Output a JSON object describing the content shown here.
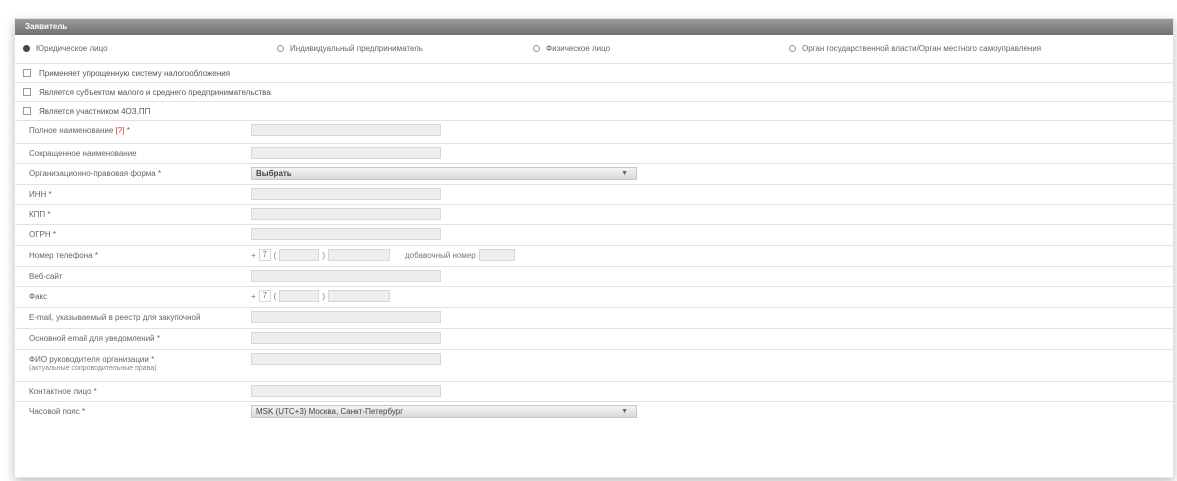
{
  "header": {
    "title": "Заявитель"
  },
  "radios": [
    {
      "label": "Юридическое лицо",
      "checked": true
    },
    {
      "label": "Индивидуальный предприниматель",
      "checked": false
    },
    {
      "label": "Физическое лицо",
      "checked": false
    },
    {
      "label": "Орган государственной власти/Орган местного самоуправления",
      "checked": false
    }
  ],
  "checkboxes": [
    {
      "label": "Применяет упрощенную систему налогообложения"
    },
    {
      "label": "Является субъектом малого и среднего предпринимательства"
    },
    {
      "label": "Является участником 4ОЗ.ПП"
    }
  ],
  "fields": {
    "full_name": {
      "label": "Полное наименование",
      "hint": "[?]",
      "req": " *"
    },
    "short_name": {
      "label": "Сокращенное наименование"
    },
    "org_form": {
      "label": "Организационно-правовая форма *",
      "value": "Выбрать"
    },
    "inn": {
      "label": "ИНН *"
    },
    "kpp": {
      "label": "КПП *"
    },
    "ogrn": {
      "label": "ОГРН *"
    },
    "phone": {
      "label": "Номер телефона *",
      "plus": "+",
      "code": "7",
      "open": "(",
      "close": ")",
      "ext_label": "добавочный номер"
    },
    "website": {
      "label": "Веб-сайт"
    },
    "fax": {
      "label": "Факс",
      "plus": "+",
      "code": "7",
      "open": "(",
      "close": ")"
    },
    "email_tender": {
      "label": "E-mail, указываемый в реестр для закупочной"
    },
    "email_notify": {
      "label": "Основной email для уведомлений *"
    },
    "director": {
      "label": "ФИО руководителя организации *",
      "sub": "(актуальные сопроводительные права)"
    },
    "contact": {
      "label": "Контактное лицо *"
    },
    "timezone": {
      "label": "Часовой пояс *",
      "value": "MSK (UTC+3) Москва, Санкт-Петербург"
    }
  }
}
